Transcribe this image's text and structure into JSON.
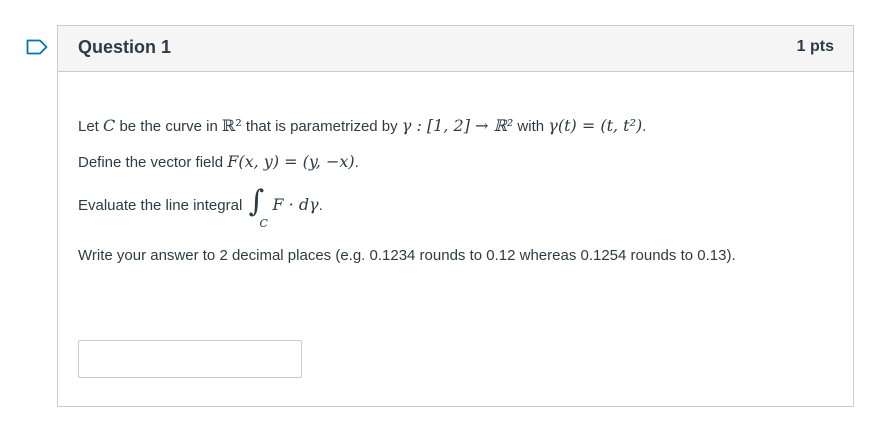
{
  "question": {
    "title": "Question 1",
    "points": "1 pts",
    "line1": {
      "t1": "Let ",
      "C": "C",
      "t2": " be the curve in ",
      "R2a": "ℝ²",
      "t3": " that is parametrized by ",
      "gamma": "γ : [1, 2] → ℝ²",
      "t4": " with ",
      "gammat": "γ(t) = (t, t²)",
      "t5": "."
    },
    "line2": {
      "t1": "Define the vector field ",
      "F": "F(x, y) = (y, −x)",
      "t2": "."
    },
    "line3": {
      "t1": "Evaluate the line integral ",
      "sign": "∫",
      "sub": "C",
      "expr": "F · dγ",
      "t2": "."
    },
    "line4": "Write your answer to 2 decimal places (e.g. 0.1234 rounds to 0.12 whereas 0.1254 rounds to 0.13).",
    "answer_value": ""
  },
  "flag_icon": "bookmark-flag-icon",
  "colors": {
    "flag": "#0374b5",
    "border": "#c7cdd1",
    "header_bg": "#f5f5f5",
    "text": "#2d3b45"
  }
}
